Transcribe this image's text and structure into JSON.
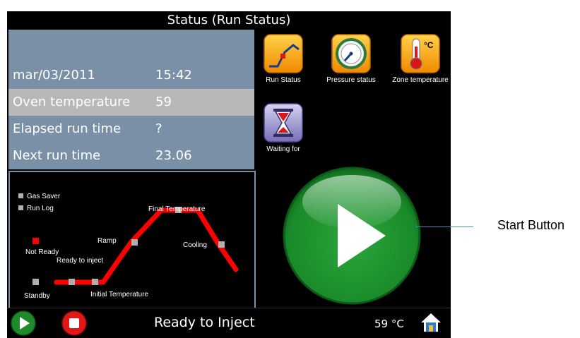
{
  "window": {
    "title": "Status (Run Status)"
  },
  "status_table": {
    "date": "mar/03/2011",
    "time": "15:42",
    "rows": [
      {
        "label": "Oven temperature",
        "value": "59",
        "highlighted": true
      },
      {
        "label": "Elapsed run time",
        "value": "?",
        "highlighted": false
      },
      {
        "label": "Next run time",
        "value": "23.06",
        "highlighted": false
      }
    ]
  },
  "diagram": {
    "legend": [
      "Gas Saver",
      "Run Log"
    ],
    "labels": {
      "not_ready": "Not Ready",
      "ready_to_inject": "Ready to inject",
      "standby": "Standby",
      "ramp": "Ramp",
      "final_temperature": "Final Temperature",
      "cooling": "Cooling",
      "initial_temperature": "Initial Temperature"
    },
    "colors": {
      "path": "#ff0000",
      "marker": "#b0b0b0",
      "not_ready": "#ff0000"
    }
  },
  "icons": [
    {
      "name": "run-status-icon",
      "label": "Run Status"
    },
    {
      "name": "pressure-status-icon",
      "label": "Pressure status"
    },
    {
      "name": "zone-temperature-icon",
      "label": "Zone temperature",
      "badge": "°C"
    },
    {
      "name": "waiting-for-icon",
      "label": "Waiting for"
    }
  ],
  "bottom_bar": {
    "status_text": "Ready to Inject",
    "temperature": "59 °C",
    "start_icon": "play-icon",
    "stop_icon": "stop-icon",
    "home_icon": "home-icon"
  },
  "annotation": {
    "label": "Start Button"
  },
  "colors": {
    "table_bg": "#7990a7",
    "highlight_row": "#b8b8b8",
    "start_green": "#1e8a2c"
  }
}
